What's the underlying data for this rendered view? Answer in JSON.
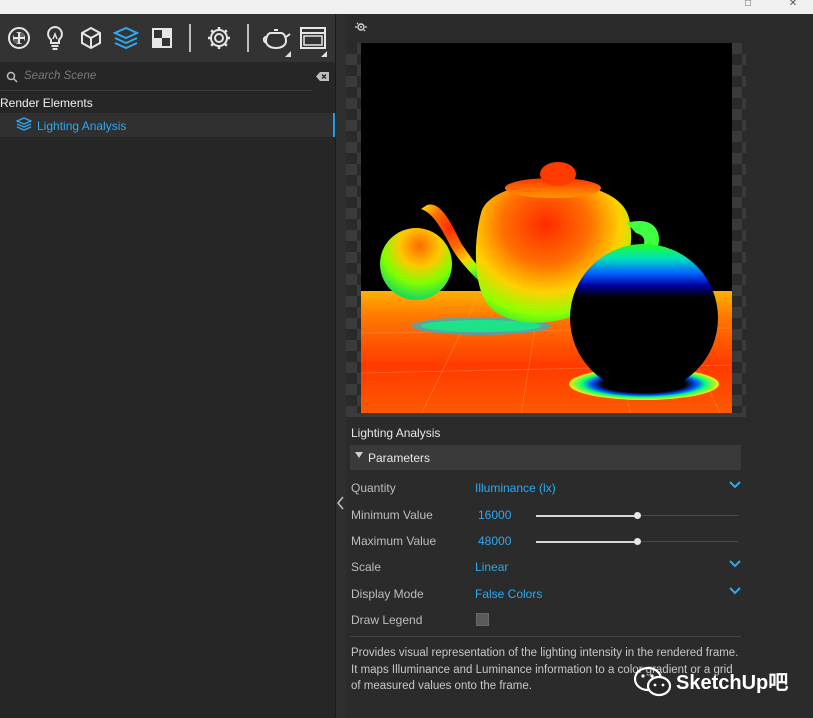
{
  "titlebar": {
    "minimize_glyph": "−",
    "maximize_glyph": "□",
    "close_glyph": "✕"
  },
  "toolbar": {
    "icons": [
      "materials-icon",
      "lights-icon",
      "geometry-icon",
      "layers-icon",
      "textures-icon",
      "settings-icon",
      "render-teapot-icon",
      "frame-buffer-icon"
    ]
  },
  "search": {
    "placeholder": "Search Scene"
  },
  "tree": {
    "header": "Render Elements",
    "selected_item": "Lighting Analysis"
  },
  "properties": {
    "title": "Lighting Analysis",
    "section": "Parameters",
    "rows": [
      {
        "label": "Quantity",
        "value": "Illuminance (lx)"
      },
      {
        "label": "Minimum Value",
        "value": "16000",
        "slider": 0.5
      },
      {
        "label": "Maximum Value",
        "value": "48000",
        "slider": 0.5
      },
      {
        "label": "Scale",
        "value": "Linear"
      },
      {
        "label": "Display Mode",
        "value": "False Colors"
      },
      {
        "label": "Draw Legend",
        "checked": false
      }
    ],
    "description": "Provides visual representation of the lighting intensity in the rendered frame. It maps Illuminance and Luminance information to a color gradient or a grid of measured values onto the frame."
  },
  "watermark": {
    "text": "SketchUp吧"
  },
  "colors": {
    "accent": "#2ea8f0",
    "panel": "#262626",
    "section": "#3a3a3a"
  }
}
